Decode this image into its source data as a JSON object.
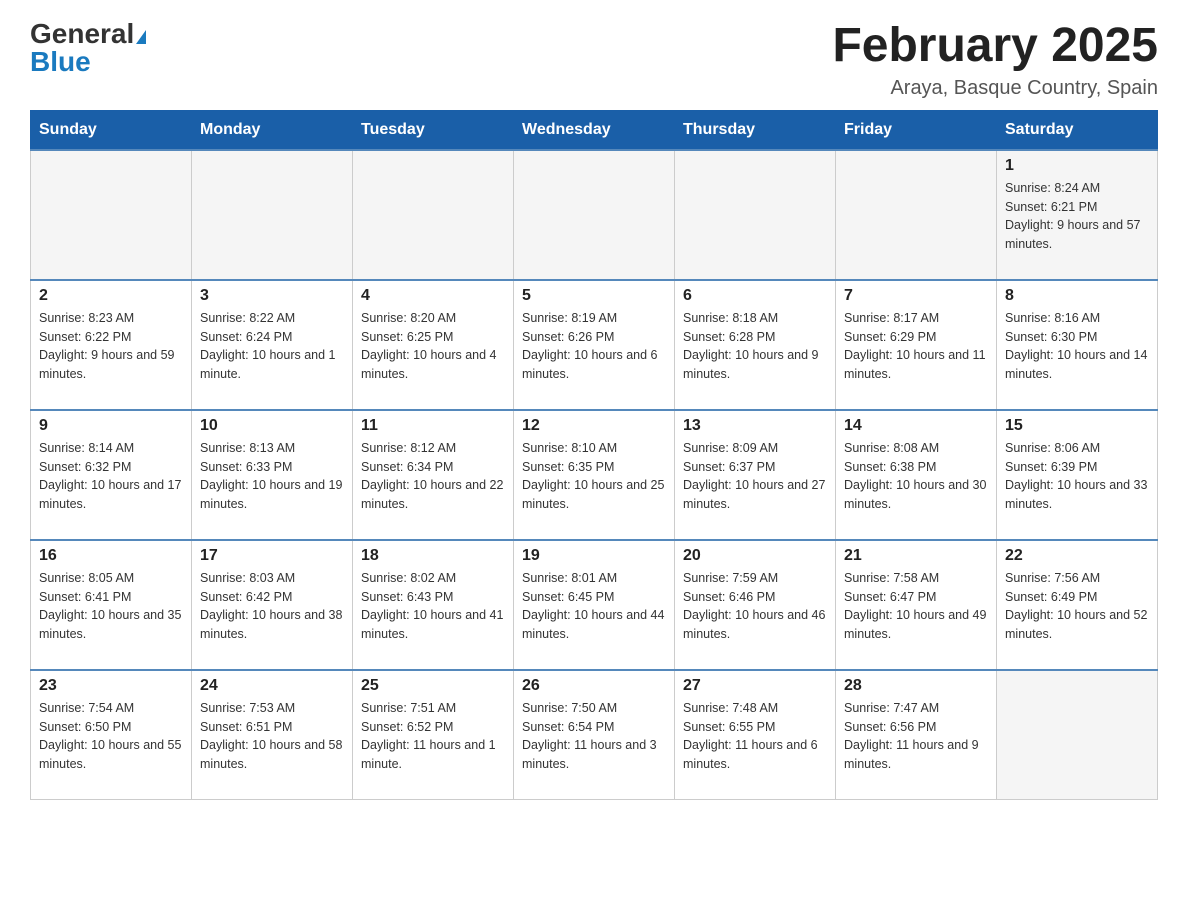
{
  "header": {
    "logo_general": "General",
    "logo_blue": "Blue",
    "month_title": "February 2025",
    "location": "Araya, Basque Country, Spain"
  },
  "days_of_week": [
    "Sunday",
    "Monday",
    "Tuesday",
    "Wednesday",
    "Thursday",
    "Friday",
    "Saturday"
  ],
  "weeks": [
    [
      {
        "day": "",
        "info": ""
      },
      {
        "day": "",
        "info": ""
      },
      {
        "day": "",
        "info": ""
      },
      {
        "day": "",
        "info": ""
      },
      {
        "day": "",
        "info": ""
      },
      {
        "day": "",
        "info": ""
      },
      {
        "day": "1",
        "info": "Sunrise: 8:24 AM\nSunset: 6:21 PM\nDaylight: 9 hours and 57 minutes."
      }
    ],
    [
      {
        "day": "2",
        "info": "Sunrise: 8:23 AM\nSunset: 6:22 PM\nDaylight: 9 hours and 59 minutes."
      },
      {
        "day": "3",
        "info": "Sunrise: 8:22 AM\nSunset: 6:24 PM\nDaylight: 10 hours and 1 minute."
      },
      {
        "day": "4",
        "info": "Sunrise: 8:20 AM\nSunset: 6:25 PM\nDaylight: 10 hours and 4 minutes."
      },
      {
        "day": "5",
        "info": "Sunrise: 8:19 AM\nSunset: 6:26 PM\nDaylight: 10 hours and 6 minutes."
      },
      {
        "day": "6",
        "info": "Sunrise: 8:18 AM\nSunset: 6:28 PM\nDaylight: 10 hours and 9 minutes."
      },
      {
        "day": "7",
        "info": "Sunrise: 8:17 AM\nSunset: 6:29 PM\nDaylight: 10 hours and 11 minutes."
      },
      {
        "day": "8",
        "info": "Sunrise: 8:16 AM\nSunset: 6:30 PM\nDaylight: 10 hours and 14 minutes."
      }
    ],
    [
      {
        "day": "9",
        "info": "Sunrise: 8:14 AM\nSunset: 6:32 PM\nDaylight: 10 hours and 17 minutes."
      },
      {
        "day": "10",
        "info": "Sunrise: 8:13 AM\nSunset: 6:33 PM\nDaylight: 10 hours and 19 minutes."
      },
      {
        "day": "11",
        "info": "Sunrise: 8:12 AM\nSunset: 6:34 PM\nDaylight: 10 hours and 22 minutes."
      },
      {
        "day": "12",
        "info": "Sunrise: 8:10 AM\nSunset: 6:35 PM\nDaylight: 10 hours and 25 minutes."
      },
      {
        "day": "13",
        "info": "Sunrise: 8:09 AM\nSunset: 6:37 PM\nDaylight: 10 hours and 27 minutes."
      },
      {
        "day": "14",
        "info": "Sunrise: 8:08 AM\nSunset: 6:38 PM\nDaylight: 10 hours and 30 minutes."
      },
      {
        "day": "15",
        "info": "Sunrise: 8:06 AM\nSunset: 6:39 PM\nDaylight: 10 hours and 33 minutes."
      }
    ],
    [
      {
        "day": "16",
        "info": "Sunrise: 8:05 AM\nSunset: 6:41 PM\nDaylight: 10 hours and 35 minutes."
      },
      {
        "day": "17",
        "info": "Sunrise: 8:03 AM\nSunset: 6:42 PM\nDaylight: 10 hours and 38 minutes."
      },
      {
        "day": "18",
        "info": "Sunrise: 8:02 AM\nSunset: 6:43 PM\nDaylight: 10 hours and 41 minutes."
      },
      {
        "day": "19",
        "info": "Sunrise: 8:01 AM\nSunset: 6:45 PM\nDaylight: 10 hours and 44 minutes."
      },
      {
        "day": "20",
        "info": "Sunrise: 7:59 AM\nSunset: 6:46 PM\nDaylight: 10 hours and 46 minutes."
      },
      {
        "day": "21",
        "info": "Sunrise: 7:58 AM\nSunset: 6:47 PM\nDaylight: 10 hours and 49 minutes."
      },
      {
        "day": "22",
        "info": "Sunrise: 7:56 AM\nSunset: 6:49 PM\nDaylight: 10 hours and 52 minutes."
      }
    ],
    [
      {
        "day": "23",
        "info": "Sunrise: 7:54 AM\nSunset: 6:50 PM\nDaylight: 10 hours and 55 minutes."
      },
      {
        "day": "24",
        "info": "Sunrise: 7:53 AM\nSunset: 6:51 PM\nDaylight: 10 hours and 58 minutes."
      },
      {
        "day": "25",
        "info": "Sunrise: 7:51 AM\nSunset: 6:52 PM\nDaylight: 11 hours and 1 minute."
      },
      {
        "day": "26",
        "info": "Sunrise: 7:50 AM\nSunset: 6:54 PM\nDaylight: 11 hours and 3 minutes."
      },
      {
        "day": "27",
        "info": "Sunrise: 7:48 AM\nSunset: 6:55 PM\nDaylight: 11 hours and 6 minutes."
      },
      {
        "day": "28",
        "info": "Sunrise: 7:47 AM\nSunset: 6:56 PM\nDaylight: 11 hours and 9 minutes."
      },
      {
        "day": "",
        "info": ""
      }
    ]
  ]
}
